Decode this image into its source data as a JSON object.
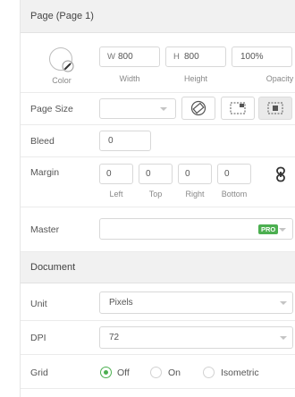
{
  "page_header": {
    "title": "Page (Page 1)"
  },
  "properties": {
    "color_label": "Color",
    "width": {
      "prefix": "W",
      "value": "800",
      "label": "Width"
    },
    "height": {
      "prefix": "H",
      "value": "800",
      "label": "Height"
    },
    "opacity": {
      "value": "100%",
      "label": "Opacity"
    }
  },
  "page_size": {
    "label": "Page Size",
    "value": ""
  },
  "bleed": {
    "label": "Bleed",
    "value": "0"
  },
  "margin": {
    "label": "Margin",
    "left": {
      "value": "0",
      "label": "Left"
    },
    "top": {
      "value": "0",
      "label": "Top"
    },
    "right": {
      "value": "0",
      "label": "Right"
    },
    "bottom": {
      "value": "0",
      "label": "Bottom"
    }
  },
  "master": {
    "label": "Master",
    "value": "",
    "badge": "PRO"
  },
  "document_header": {
    "title": "Document"
  },
  "unit": {
    "label": "Unit",
    "value": "Pixels"
  },
  "dpi": {
    "label": "DPI",
    "value": "72"
  },
  "grid": {
    "label": "Grid",
    "options": [
      {
        "label": "Off",
        "selected": true
      },
      {
        "label": "On",
        "selected": false
      },
      {
        "label": "Isometric",
        "selected": false
      }
    ]
  },
  "colors": {
    "accent": "#4caf50",
    "header_bg": "#f1f1f1",
    "border": "#d8d8d8"
  }
}
